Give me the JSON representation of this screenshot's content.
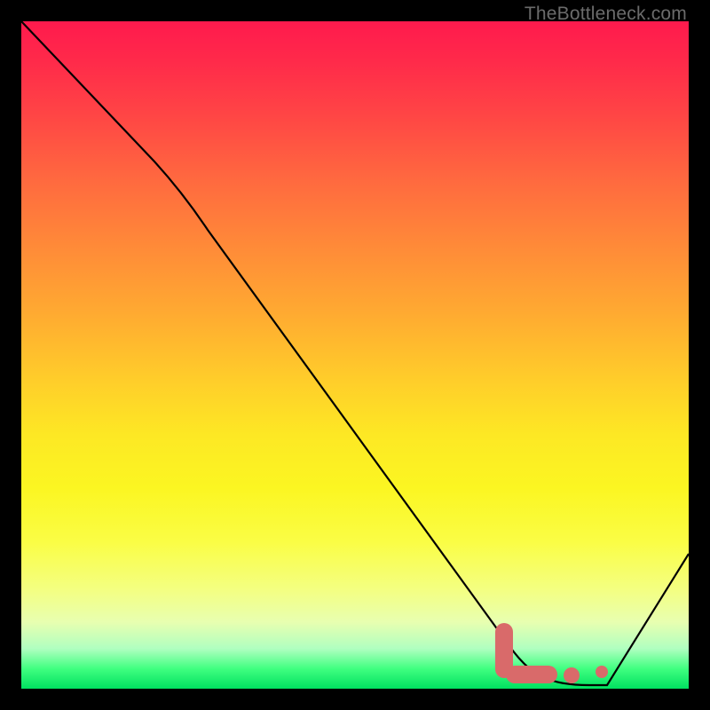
{
  "watermark": "TheBottleneck.com",
  "chart_data": {
    "type": "line",
    "title": "",
    "xlabel": "",
    "ylabel": "",
    "xlim": [
      0,
      100
    ],
    "ylim": [
      0,
      100
    ],
    "grid": false,
    "series": [
      {
        "name": "bottleneck-curve",
        "x": [
          0,
          20,
          72,
          78,
          82,
          86,
          100
        ],
        "values": [
          100,
          79,
          8,
          1,
          0,
          0,
          21
        ]
      }
    ],
    "markers": [
      {
        "name": "optimal-range-start",
        "x": 72,
        "y": 8
      },
      {
        "name": "optimal-range-mid1",
        "x": 76,
        "y": 2
      },
      {
        "name": "optimal-range-mid2",
        "x": 80,
        "y": 1
      },
      {
        "name": "optimal-range-end",
        "x": 86,
        "y": 0
      }
    ],
    "annotations": []
  }
}
